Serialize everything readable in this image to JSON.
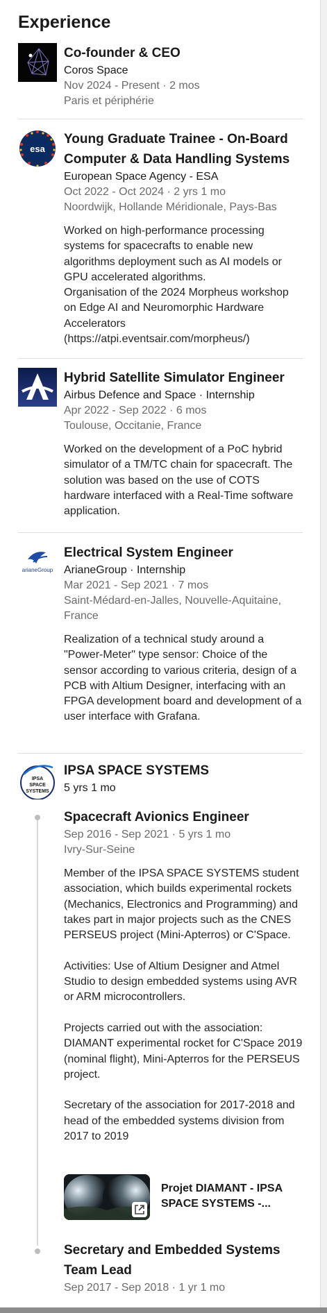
{
  "section": {
    "title": "Experience"
  },
  "entries": [
    {
      "role": "Co-founder & CEO",
      "company": "Coros Space",
      "dates": "Nov 2024 - Present · 2 mos",
      "location": "Paris et périphérie"
    },
    {
      "role": "Young Graduate Trainee - On-Board Computer & Data Handling Systems",
      "company": "European Space Agency - ESA",
      "dates": "Oct 2022 - Oct 2024 · 2 yrs 1 mo",
      "location": "Noordwijk, Hollande Méridionale, Pays-Bas",
      "description": "Worked on high-performance processing systems for spacecrafts to enable new algorithms deployment such as AI models or GPU accelerated algorithms.\nOrganisation of the 2024 Morpheus workshop on Edge AI and Neuromorphic Hardware Accelerators (https://atpi.eventsair.com/morpheus/)",
      "logo_text": "esa"
    },
    {
      "role": "Hybrid Satellite Simulator Engineer",
      "company": "Airbus Defence and Space · Internship",
      "dates": "Apr 2022 - Sep 2022 · 6 mos",
      "location": "Toulouse, Occitanie, France",
      "description": "Worked on the development of a PoC hybrid simulator of a TM/TC chain for spacecraft. The solution was based on the use of COTS hardware interfaced with a Real-Time software application."
    },
    {
      "role": "Electrical System Engineer",
      "company": "ArianeGroup · Internship",
      "dates": "Mar 2021 - Sep 2021 · 7 mos",
      "location": "Saint-Médard-en-Jalles, Nouvelle-Aquitaine, France",
      "description": "Realization of a technical study around a \"Power-Meter\" type sensor: Choice of the sensor according to various criteria, design of a PCB with Altium Designer, interfacing with an FPGA development board and development of a user interface with Grafana.",
      "logo_text": "arianeGroup"
    },
    {
      "company_name": "IPSA SPACE SYSTEMS",
      "total_duration": "5 yrs 1 mo",
      "logo_text": "IPSA SPACE SYSTEMS",
      "positions": [
        {
          "role": "Spacecraft Avionics Engineer",
          "dates": "Sep 2016 - Sep 2021 · 5 yrs 1 mo",
          "location": "Ivry-Sur-Seine",
          "description": "Member of the IPSA SPACE SYSTEMS student association, which builds experimental rockets (Mechanics, Electronics and Programming) and takes part in major projects such as the CNES PERSEUS project (Mini-Apterros) or C'Space.\n\nActivities: Use of Altium Designer and Atmel Studio to design embedded systems using AVR or ARM microcontrollers.\n\nProjects carried out with the association: DIAMANT experimental rocket for C'Space 2019 (nominal flight), Mini-Apterros for the PERSEUS project.\n\nSecretary of the association for 2017-2018 and head of the embedded systems division from 2017 to 2019",
          "media_title": "Projet DIAMANT - IPSA SPACE SYSTEMS -..."
        },
        {
          "role": "Secretary and Embedded Systems Team Lead",
          "dates": "Sep 2017 - Sep 2018 · 1 yr 1 mo"
        }
      ]
    }
  ]
}
